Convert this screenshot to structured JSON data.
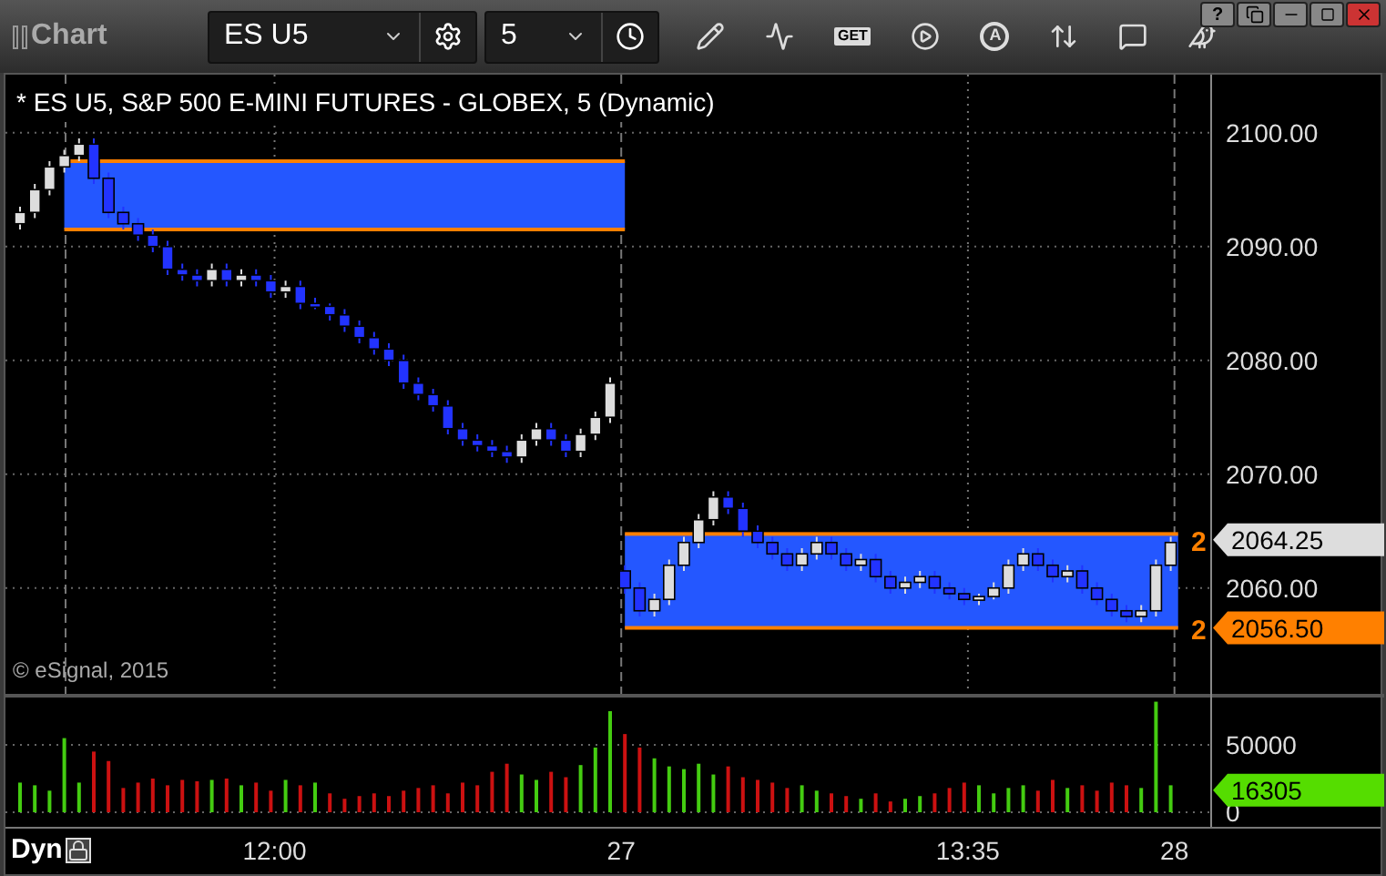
{
  "window": {
    "title": "Chart",
    "buttons": [
      {
        "kind": "help",
        "text": "?"
      },
      {
        "kind": "restore"
      },
      {
        "kind": "minimize"
      },
      {
        "kind": "maximize"
      },
      {
        "kind": "close"
      }
    ]
  },
  "toolbar": {
    "symbol": "ES U5",
    "interval": "5",
    "tools": [
      {
        "kind": "pencil"
      },
      {
        "kind": "chart"
      },
      {
        "kind": "text",
        "text": "GET"
      },
      {
        "kind": "play"
      },
      {
        "kind": "letter",
        "text": "A"
      },
      {
        "kind": "arrows"
      },
      {
        "kind": "comment"
      },
      {
        "kind": "bird"
      }
    ]
  },
  "legend": "* ES U5, S&P 500 E-MINI FUTURES - GLOBEX, 5 (Dynamic)",
  "copyright": "© eSignal, 2015",
  "price_chart": {
    "chart_data": {
      "type": "candlestick",
      "grid": true,
      "ylim": [
        2050.7,
        2105.1
      ],
      "yticks": [
        {
          "value": 2060,
          "label": "2060.00"
        },
        {
          "value": 2070,
          "label": "2070.00"
        },
        {
          "value": 2080,
          "label": "2080.00"
        },
        {
          "value": 2090,
          "label": "2090.00"
        },
        {
          "value": 2100,
          "label": "2100.00"
        }
      ],
      "ohlc": [
        [
          2092,
          2093.5,
          2091.5,
          2093
        ],
        [
          2093,
          2095.5,
          2092.5,
          2095
        ],
        [
          2095,
          2097.5,
          2094.5,
          2097
        ],
        [
          2097,
          2098.5,
          2096.5,
          2098
        ],
        [
          2098,
          2099.5,
          2097.5,
          2099
        ],
        [
          2099,
          2099.5,
          2095.5,
          2096
        ],
        [
          2096,
          2096.5,
          2092.5,
          2093
        ],
        [
          2093,
          2093.5,
          2091.5,
          2092
        ],
        [
          2092,
          2092.5,
          2090.5,
          2091
        ],
        [
          2091,
          2091.5,
          2089.5,
          2090
        ],
        [
          2090,
          2090.5,
          2087.5,
          2088
        ],
        [
          2088,
          2088.5,
          2087,
          2087.5
        ],
        [
          2087.5,
          2088,
          2086.5,
          2087
        ],
        [
          2087,
          2088.5,
          2086.5,
          2088
        ],
        [
          2088,
          2088.5,
          2086.5,
          2087
        ],
        [
          2087,
          2088,
          2086.5,
          2087.5
        ],
        [
          2087.5,
          2088,
          2086.5,
          2087
        ],
        [
          2087,
          2087.5,
          2085.5,
          2086
        ],
        [
          2086,
          2087,
          2085.5,
          2086.5
        ],
        [
          2086.5,
          2087,
          2084.5,
          2085
        ],
        [
          2085,
          2085.5,
          2084.5,
          2084.75
        ],
        [
          2084.75,
          2085,
          2083.5,
          2084
        ],
        [
          2084,
          2084.5,
          2082.5,
          2083
        ],
        [
          2083,
          2083.5,
          2081.5,
          2082
        ],
        [
          2082,
          2082.5,
          2080.5,
          2081
        ],
        [
          2081,
          2081.5,
          2079.5,
          2080
        ],
        [
          2080,
          2080.5,
          2077.5,
          2078
        ],
        [
          2078,
          2078.5,
          2076.5,
          2077
        ],
        [
          2077,
          2077.5,
          2075.5,
          2076
        ],
        [
          2076,
          2076.5,
          2073.5,
          2074
        ],
        [
          2074,
          2074.5,
          2072.5,
          2073
        ],
        [
          2073,
          2073.5,
          2072,
          2072.5
        ],
        [
          2072.5,
          2073,
          2071.5,
          2072
        ],
        [
          2072,
          2072.5,
          2071,
          2071.5
        ],
        [
          2071.5,
          2073.5,
          2071,
          2073
        ],
        [
          2073,
          2074.5,
          2072.5,
          2074
        ],
        [
          2074,
          2074.5,
          2072.5,
          2073
        ],
        [
          2073,
          2073.5,
          2071.5,
          2072
        ],
        [
          2072,
          2074,
          2071.5,
          2073.5
        ],
        [
          2073.5,
          2075.5,
          2073,
          2075
        ],
        [
          2075,
          2078.5,
          2074.5,
          2078
        ],
        [
          2061.5,
          2062,
          2059.5,
          2060
        ],
        [
          2060,
          2060.5,
          2057.5,
          2058
        ],
        [
          2058,
          2059.5,
          2057.5,
          2059
        ],
        [
          2059,
          2062.5,
          2058.5,
          2062
        ],
        [
          2062,
          2064.5,
          2061.5,
          2064
        ],
        [
          2064,
          2066.5,
          2063.5,
          2066
        ],
        [
          2066,
          2068.5,
          2065.5,
          2068
        ],
        [
          2068,
          2068.5,
          2066.5,
          2067
        ],
        [
          2067,
          2067.5,
          2064.5,
          2065
        ],
        [
          2065,
          2065.5,
          2063.5,
          2064
        ],
        [
          2064,
          2064.5,
          2062.5,
          2063
        ],
        [
          2063,
          2063.5,
          2061.5,
          2062
        ],
        [
          2062,
          2063.5,
          2061.5,
          2063
        ],
        [
          2063,
          2064.5,
          2062.5,
          2064
        ],
        [
          2064,
          2064.5,
          2062.5,
          2063
        ],
        [
          2063,
          2063.5,
          2061.5,
          2062
        ],
        [
          2062,
          2063,
          2061.5,
          2062.5
        ],
        [
          2062.5,
          2063,
          2060.5,
          2061
        ],
        [
          2061,
          2061.5,
          2059.5,
          2060
        ],
        [
          2060,
          2061,
          2059.5,
          2060.5
        ],
        [
          2060.5,
          2061.5,
          2060,
          2061
        ],
        [
          2061,
          2061.5,
          2059.5,
          2060
        ],
        [
          2060,
          2060.5,
          2059,
          2059.5
        ],
        [
          2059.5,
          2060,
          2058.5,
          2059
        ],
        [
          2059,
          2059.5,
          2058.5,
          2059.25
        ],
        [
          2059.25,
          2060.5,
          2059,
          2060
        ],
        [
          2060,
          2062.5,
          2059.5,
          2062
        ],
        [
          2062,
          2063.5,
          2061.5,
          2063
        ],
        [
          2063,
          2063.5,
          2061.5,
          2062
        ],
        [
          2062,
          2062.5,
          2060.5,
          2061
        ],
        [
          2061,
          2062,
          2060.5,
          2061.5
        ],
        [
          2061.5,
          2062,
          2059.5,
          2060
        ],
        [
          2060,
          2060.5,
          2058.5,
          2059
        ],
        [
          2059,
          2059.5,
          2057.5,
          2058
        ],
        [
          2058,
          2058.5,
          2057,
          2057.5
        ],
        [
          2057.5,
          2058.5,
          2057,
          2058
        ],
        [
          2058,
          2062.5,
          2057.5,
          2062
        ],
        [
          2062,
          2064.5,
          2061.5,
          2064
        ]
      ]
    },
    "price_markers": [
      {
        "value": "2064.25",
        "cut_label": "2",
        "color": "#dddddd"
      },
      {
        "value": "2056.50",
        "cut_label": "2",
        "color": "#ff8000"
      }
    ]
  },
  "volume_chart": {
    "chart_data": {
      "type": "bar",
      "grid": true,
      "ylim": [
        0,
        87800
      ],
      "yticks": [
        0,
        50000
      ],
      "series": [
        {
          "color": "#44cc11",
          "values": [
            22000,
            20000,
            16000,
            55000,
            22000,
            null,
            null,
            null,
            null,
            null,
            null,
            null,
            null,
            24000,
            null,
            20000,
            null,
            null,
            24000,
            null,
            22000,
            null,
            null,
            null,
            null,
            null,
            null,
            null,
            null,
            null,
            null,
            null,
            null,
            null,
            28000,
            24000,
            null,
            null,
            35000,
            48000,
            75000,
            null,
            null,
            40000,
            34000,
            32000,
            36000,
            28000,
            null,
            null,
            null,
            null,
            null,
            20000,
            16000,
            null,
            null,
            10000,
            null,
            null,
            10000,
            12000,
            null,
            null,
            null,
            20000,
            14000,
            18000,
            20000,
            null,
            null,
            18000,
            null,
            null,
            null,
            null,
            18000,
            82000,
            20000
          ]
        },
        {
          "color": "#cc1111",
          "values": [
            null,
            null,
            null,
            null,
            null,
            45000,
            38000,
            18000,
            22000,
            25000,
            20000,
            24000,
            23000,
            null,
            25000,
            null,
            22000,
            16000,
            null,
            20000,
            null,
            14000,
            10000,
            12000,
            14000,
            12000,
            16000,
            18000,
            20000,
            14000,
            22000,
            20000,
            30000,
            36000,
            null,
            null,
            30000,
            26000,
            null,
            null,
            null,
            58000,
            48000,
            null,
            null,
            null,
            null,
            null,
            34000,
            26000,
            24000,
            22000,
            18000,
            null,
            null,
            14000,
            12000,
            null,
            14000,
            8000,
            null,
            null,
            14000,
            18000,
            22000,
            null,
            null,
            null,
            null,
            16000,
            24000,
            null,
            20000,
            16000,
            22000,
            20000,
            null,
            null,
            null
          ]
        }
      ]
    },
    "last_volume": {
      "value": "16305",
      "color": "#55dd00"
    }
  },
  "time_axis": {
    "mode": "Dyn",
    "labels": [
      "12:00",
      "27",
      "13:35",
      "28"
    ]
  }
}
